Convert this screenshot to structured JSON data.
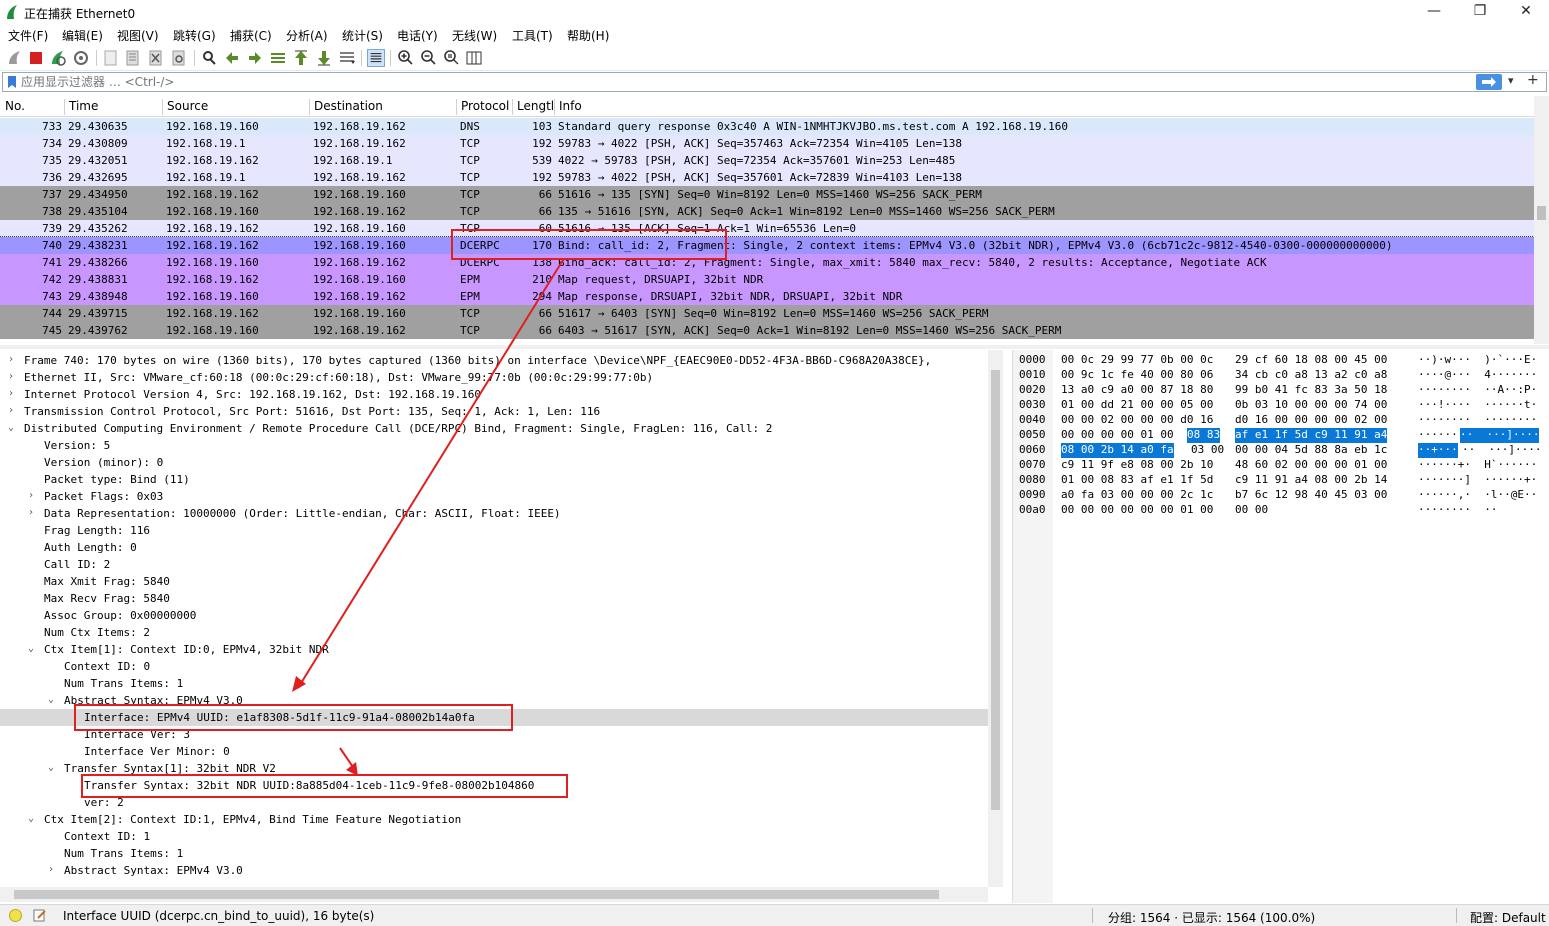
{
  "window": {
    "title": "正在捕获 Ethernet0",
    "minimize": "—",
    "maximize": "❐",
    "close": "✕"
  },
  "menu": [
    "文件(F)",
    "编辑(E)",
    "视图(V)",
    "跳转(G)",
    "捕获(C)",
    "分析(A)",
    "统计(S)",
    "电话(Y)",
    "无线(W)",
    "工具(T)",
    "帮助(H)"
  ],
  "filter": {
    "placeholder": "应用显示过滤器 … <Ctrl-/>"
  },
  "columns": [
    "No.",
    "Time",
    "Source",
    "Destination",
    "Protocol",
    "Lengtl",
    "Info"
  ],
  "packets": [
    {
      "no": "733",
      "time": "29.430635",
      "src": "192.168.19.160",
      "dst": "192.168.19.162",
      "proto": "DNS",
      "len": "103",
      "info": "Standard query response 0x3c40 A WIN-1NMHTJKVJBO.ms.test.com A 192.168.19.160"
    },
    {
      "no": "734",
      "time": "29.430809",
      "src": "192.168.19.1",
      "dst": "192.168.19.162",
      "proto": "TCP",
      "len": "192",
      "info": "59783 → 4022 [PSH, ACK] Seq=357463 Ack=72354 Win=4105 Len=138"
    },
    {
      "no": "735",
      "time": "29.432051",
      "src": "192.168.19.162",
      "dst": "192.168.19.1",
      "proto": "TCP",
      "len": "539",
      "info": "4022 → 59783 [PSH, ACK] Seq=72354 Ack=357601 Win=253 Len=485"
    },
    {
      "no": "736",
      "time": "29.432695",
      "src": "192.168.19.1",
      "dst": "192.168.19.162",
      "proto": "TCP",
      "len": "192",
      "info": "59783 → 4022 [PSH, ACK] Seq=357601 Ack=72839 Win=4103 Len=138"
    },
    {
      "no": "737",
      "time": "29.434950",
      "src": "192.168.19.162",
      "dst": "192.168.19.160",
      "proto": "TCP",
      "len": "66",
      "info": "51616 → 135 [SYN] Seq=0 Win=8192 Len=0 MSS=1460 WS=256 SACK_PERM"
    },
    {
      "no": "738",
      "time": "29.435104",
      "src": "192.168.19.160",
      "dst": "192.168.19.162",
      "proto": "TCP",
      "len": "66",
      "info": "135 → 51616 [SYN, ACK] Seq=0 Ack=1 Win=8192 Len=0 MSS=1460 WS=256 SACK_PERM"
    },
    {
      "no": "739",
      "time": "29.435262",
      "src": "192.168.19.162",
      "dst": "192.168.19.160",
      "proto": "TCP",
      "len": "60",
      "info": "51616 → 135 [ACK] Seq=1 Ack=1 Win=65536 Len=0"
    },
    {
      "no": "740",
      "time": "29.438231",
      "src": "192.168.19.162",
      "dst": "192.168.19.160",
      "proto": "DCERPC",
      "len": "170",
      "info": "Bind: call_id: 2, Fragment: Single, 2 context items: EPMv4 V3.0 (32bit NDR), EPMv4 V3.0 (6cb71c2c-9812-4540-0300-000000000000)"
    },
    {
      "no": "741",
      "time": "29.438266",
      "src": "192.168.19.160",
      "dst": "192.168.19.162",
      "proto": "DCERPC",
      "len": "138",
      "info": "Bind_ack: call_id: 2, Fragment: Single, max_xmit: 5840 max_recv: 5840, 2 results: Acceptance, Negotiate ACK"
    },
    {
      "no": "742",
      "time": "29.438831",
      "src": "192.168.19.162",
      "dst": "192.168.19.160",
      "proto": "EPM",
      "len": "210",
      "info": "Map request, DRSUAPI, 32bit NDR"
    },
    {
      "no": "743",
      "time": "29.438948",
      "src": "192.168.19.160",
      "dst": "192.168.19.162",
      "proto": "EPM",
      "len": "294",
      "info": "Map response, DRSUAPI, 32bit NDR, DRSUAPI, 32bit NDR"
    },
    {
      "no": "744",
      "time": "29.439715",
      "src": "192.168.19.162",
      "dst": "192.168.19.160",
      "proto": "TCP",
      "len": "66",
      "info": "51617 → 6403 [SYN] Seq=0 Win=8192 Len=0 MSS=1460 WS=256 SACK_PERM"
    },
    {
      "no": "745",
      "time": "29.439762",
      "src": "192.168.19.160",
      "dst": "192.168.19.162",
      "proto": "TCP",
      "len": "66",
      "info": "6403 → 51617 [SYN, ACK] Seq=0 Ack=1 Win=8192 Len=0 MSS=1460 WS=256 SACK_PERM"
    }
  ],
  "row_colors": {
    "dns": "#dae8fc",
    "tcp_light": "#e7e6ff",
    "tcp_gray": "#a0a0a0",
    "dcerpc": "#c797ff",
    "selected": "#9c95ff"
  },
  "details": [
    {
      "indent": 0,
      "arrow": "›",
      "text": "Frame 740: 170 bytes on wire (1360 bits), 170 bytes captured (1360 bits) on interface \\Device\\NPF_{EAEC90E0-DD52-4F3A-BB6D-C968A20A38CE},"
    },
    {
      "indent": 0,
      "arrow": "›",
      "text": "Ethernet II, Src: VMware_cf:60:18 (00:0c:29:cf:60:18), Dst: VMware_99:77:0b (00:0c:29:99:77:0b)"
    },
    {
      "indent": 0,
      "arrow": "›",
      "text": "Internet Protocol Version 4, Src: 192.168.19.162, Dst: 192.168.19.160"
    },
    {
      "indent": 0,
      "arrow": "›",
      "text": "Transmission Control Protocol, Src Port: 51616, Dst Port: 135, Seq: 1, Ack: 1, Len: 116"
    },
    {
      "indent": 0,
      "arrow": "⌄",
      "text": "Distributed Computing Environment / Remote Procedure Call (DCE/RPC) Bind, Fragment: Single, FragLen: 116, Call: 2"
    },
    {
      "indent": 1,
      "arrow": "",
      "text": "Version: 5"
    },
    {
      "indent": 1,
      "arrow": "",
      "text": "Version (minor): 0"
    },
    {
      "indent": 1,
      "arrow": "",
      "text": "Packet type: Bind (11)"
    },
    {
      "indent": 1,
      "arrow": "›",
      "text": "Packet Flags: 0x03"
    },
    {
      "indent": 1,
      "arrow": "›",
      "text": "Data Representation: 10000000 (Order: Little-endian, Char: ASCII, Float: IEEE)"
    },
    {
      "indent": 1,
      "arrow": "",
      "text": "Frag Length: 116"
    },
    {
      "indent": 1,
      "arrow": "",
      "text": "Auth Length: 0"
    },
    {
      "indent": 1,
      "arrow": "",
      "text": "Call ID: 2"
    },
    {
      "indent": 1,
      "arrow": "",
      "text": "Max Xmit Frag: 5840"
    },
    {
      "indent": 1,
      "arrow": "",
      "text": "Max Recv Frag: 5840"
    },
    {
      "indent": 1,
      "arrow": "",
      "text": "Assoc Group: 0x00000000"
    },
    {
      "indent": 1,
      "arrow": "",
      "text": "Num Ctx Items: 2"
    },
    {
      "indent": 1,
      "arrow": "⌄",
      "text": "Ctx Item[1]: Context ID:0, EPMv4, 32bit NDR"
    },
    {
      "indent": 2,
      "arrow": "",
      "text": "Context ID: 0"
    },
    {
      "indent": 2,
      "arrow": "",
      "text": "Num Trans Items: 1"
    },
    {
      "indent": 2,
      "arrow": "⌄",
      "text": "Abstract Syntax: EPMv4 V3.0"
    },
    {
      "indent": 3,
      "arrow": "",
      "text": "Interface: EPMv4 UUID: e1af8308-5d1f-11c9-91a4-08002b14a0fa"
    },
    {
      "indent": 3,
      "arrow": "",
      "text": "Interface Ver: 3"
    },
    {
      "indent": 3,
      "arrow": "",
      "text": "Interface Ver Minor: 0"
    },
    {
      "indent": 2,
      "arrow": "⌄",
      "text": "Transfer Syntax[1]: 32bit NDR V2"
    },
    {
      "indent": 3,
      "arrow": "",
      "text": "Transfer Syntax: 32bit NDR UUID:8a885d04-1ceb-11c9-9fe8-08002b104860"
    },
    {
      "indent": 3,
      "arrow": "",
      "text": "ver: 2"
    },
    {
      "indent": 1,
      "arrow": "⌄",
      "text": "Ctx Item[2]: Context ID:1, EPMv4, Bind Time Feature Negotiation"
    },
    {
      "indent": 2,
      "arrow": "",
      "text": "Context ID: 1"
    },
    {
      "indent": 2,
      "arrow": "",
      "text": "Num Trans Items: 1"
    },
    {
      "indent": 2,
      "arrow": "›",
      "text": "Abstract Syntax: EPMv4 V3.0"
    }
  ],
  "bytes": [
    {
      "off": "0000",
      "hex1": "00 0c 29 99 77 0b 00 0c",
      "hex2": "29 cf 60 18 08 00 45 00",
      "ascii": "··)·w···  )·`···E·"
    },
    {
      "off": "0010",
      "hex1": "00 9c 1c fe 40 00 80 06",
      "hex2": "34 cb c0 a8 13 a2 c0 a8",
      "ascii": "····@···  4·······"
    },
    {
      "off": "0020",
      "hex1": "13 a0 c9 a0 00 87 18 80",
      "hex2": "99 b0 41 fc 83 3a 50 18",
      "ascii": "········  ··A··:P·"
    },
    {
      "off": "0030",
      "hex1": "01 00 dd 21 00 00 05 00",
      "hex2": "0b 03 10 00 00 00 74 00",
      "ascii": "···!····  ······t·"
    },
    {
      "off": "0040",
      "hex1": "00 00 02 00 00 00 d0 16",
      "hex2": "d0 16 00 00 00 00 02 00",
      "ascii": "········  ········"
    },
    {
      "off": "0050",
      "hex1": "00 00 00 00 01 00",
      "hexsel1": "08 83",
      "hex2sel": "af e1 1f 5d c9 11 91 a4",
      "ascii": "······",
      "asciisel": "··  ···]····"
    },
    {
      "off": "0060",
      "hex1sel": "08 00 2b 14 a0 fa",
      "hex1rest": "03 00",
      "hex2": "00 00 04 5d 88 8a eb 1c",
      "asciisel": "··+···",
      "ascii": "··  ···]····"
    },
    {
      "off": "0070",
      "hex1": "c9 11 9f e8 08 00 2b 10",
      "hex2": "48 60 02 00 00 00 01 00",
      "ascii": "······+·  H`······"
    },
    {
      "off": "0080",
      "hex1": "01 00 08 83 af e1 1f 5d",
      "hex2": "c9 11 91 a4 08 00 2b 14",
      "ascii": "·······]  ······+·"
    },
    {
      "off": "0090",
      "hex1": "a0 fa 03 00 00 00 2c 1c",
      "hex2": "b7 6c 12 98 40 45 03 00",
      "ascii": "······,·  ·l··@E··"
    },
    {
      "off": "00a0",
      "hex1": "00 00 00 00 00 00 01 00",
      "hex2": "00 00",
      "ascii": "········  ··"
    }
  ],
  "status": {
    "field": "Interface UUID (dcerpc.cn_bind_to_uuid), 16 byte(s)",
    "packets": "分组: 1564 · 已显示: 1564 (100.0%)",
    "profile": "配置: Default"
  }
}
